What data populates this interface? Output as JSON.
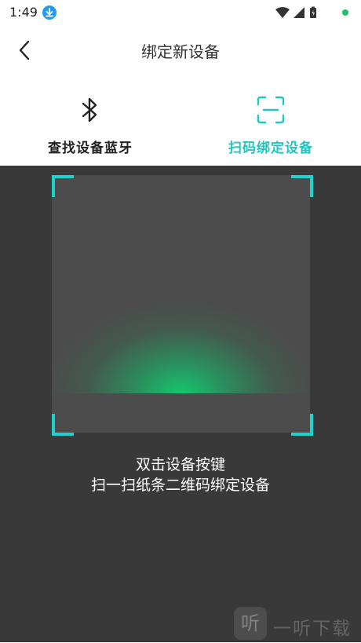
{
  "status_bar": {
    "time": "1:49",
    "icons": [
      "download-icon",
      "wifi-icon",
      "signal-icon",
      "battery-icon",
      "notification-dot-icon"
    ]
  },
  "header": {
    "title": "绑定新设备",
    "back_icon": "chevron-left-icon"
  },
  "tabs": [
    {
      "label": "查找设备蓝牙",
      "icon": "bluetooth-icon",
      "active": false
    },
    {
      "label": "扫码绑定设备",
      "icon": "scan-frame-icon",
      "active": true
    }
  ],
  "scanner": {
    "hint_line1": "双击设备按键",
    "hint_line2": "扫一扫纸条二维码绑定设备"
  },
  "watermark": {
    "logo_char": "听",
    "text": "一听下载"
  },
  "colors": {
    "accent": "#1fd3cc",
    "scan_beam": "#12cd6e",
    "scanner_bg": "#393939",
    "frame_bg": "#4c4c4c"
  }
}
